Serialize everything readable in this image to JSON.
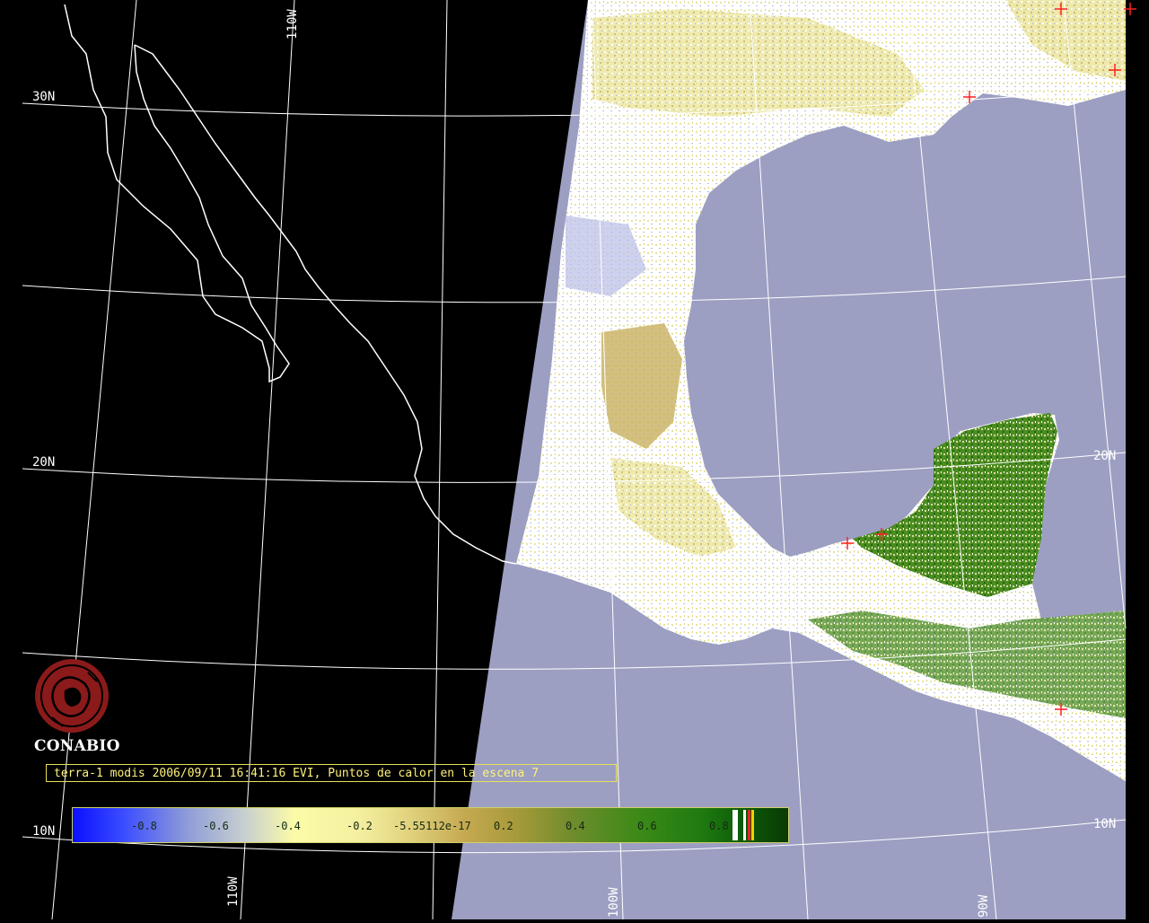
{
  "map": {
    "org": "CONABIO",
    "caption": "terra-1 modis 2006/09/11 16:41:16 EVI, Puntos de calor en la escena 7",
    "latitude_labels": [
      "30N",
      "20N",
      "10N",
      "20N",
      "10N"
    ],
    "longitude_labels": [
      "110W",
      "110W",
      "100W",
      "90W"
    ],
    "colors": {
      "background_no_data": "#000000",
      "ocean": "#9c9fc2",
      "land_cloud": "#ffffff",
      "graticule": "#ffffff",
      "coastline": "#ffffff",
      "hotspot": "#ff2020",
      "caption_text": "#fff27a",
      "logo": "#8b1a1a"
    },
    "hotspot_count": 7
  },
  "legend": {
    "title": "EVI",
    "ticks": [
      "-0.8",
      "-0.6",
      "-0.4",
      "-0.2",
      "-5.55112e-17",
      "0.2",
      "0.4",
      "0.6",
      "0.8"
    ],
    "colors": [
      "#0a10ff",
      "#8f9cd8",
      "#fbfba8",
      "#e1d27e",
      "#a79a3a",
      "#3c8a18",
      "#0c5a08"
    ]
  }
}
